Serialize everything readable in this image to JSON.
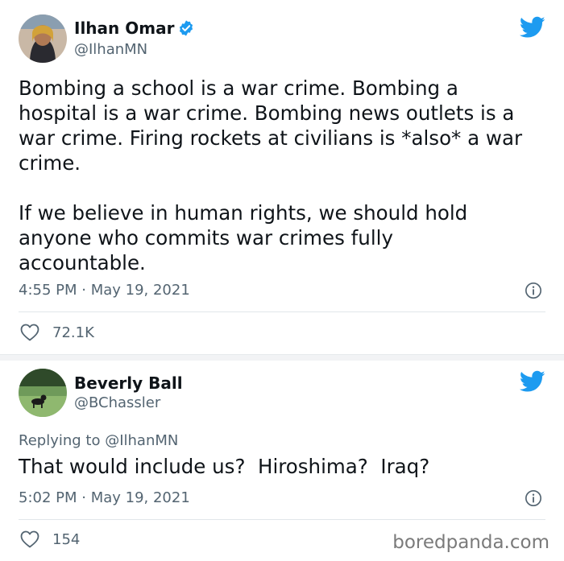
{
  "tweet1": {
    "author_name": "Ilhan Omar",
    "author_handle": "@IlhanMN",
    "text_lines": [
      "Bombing a school is a war crime. Bombing a",
      "hospital is a war crime. Bombing news outlets is a",
      "war crime. Firing rockets at civilians is *also* a war",
      "crime."
    ],
    "text_lines_2": [
      "If we believe in human rights, we should hold",
      "anyone who commits war crimes fully",
      "accountable."
    ],
    "timestamp": "4:55 PM · May 19, 2021",
    "likes": "72.1K"
  },
  "tweet2": {
    "author_name": "Beverly Ball",
    "author_handle": "@BChassler",
    "replying_label": "Replying to",
    "replying_to": "@IlhanMN",
    "text": "That would include us?  Hiroshima?  Iraq?",
    "timestamp": "5:02 PM · May 19, 2021",
    "likes": "154"
  },
  "watermark": "boredpanda.com",
  "colors": {
    "twitter_blue": "#1d9bf0",
    "text": "#0f1419",
    "secondary": "#536471"
  },
  "icons": {
    "brand": "twitter-bird-icon",
    "verified": "verified-badge-icon",
    "info": "info-icon",
    "like": "heart-icon"
  }
}
